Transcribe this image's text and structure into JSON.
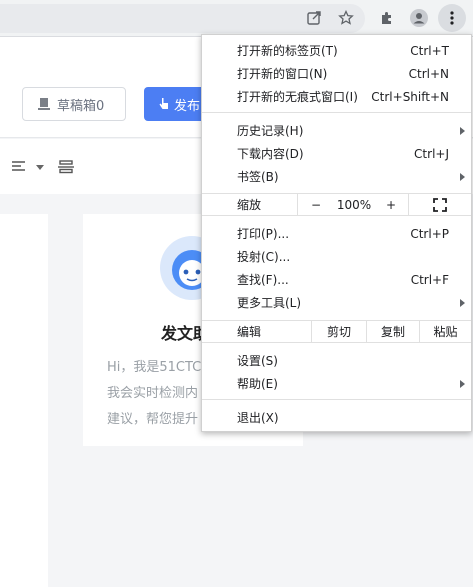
{
  "browser": {
    "icons": [
      "share-icon",
      "star-icon",
      "extensions-icon",
      "profile-icon",
      "kebab-menu-icon"
    ]
  },
  "page": {
    "draft_label": "草稿箱0",
    "publish_label": "发布",
    "assistant_title": "发文助",
    "assistant_line1": "Hi，我是51CTC",
    "assistant_line2": "我会实时检测内",
    "assistant_line3": "建议，帮您提升"
  },
  "menu": {
    "new_tab": {
      "label": "打开新的标签页(T)",
      "shortcut": "Ctrl+T"
    },
    "new_window": {
      "label": "打开新的窗口(N)",
      "shortcut": "Ctrl+N"
    },
    "new_incognito": {
      "label": "打开新的无痕式窗口(I)",
      "shortcut": "Ctrl+Shift+N"
    },
    "history": {
      "label": "历史记录(H)"
    },
    "downloads": {
      "label": "下载内容(D)",
      "shortcut": "Ctrl+J"
    },
    "bookmarks": {
      "label": "书签(B)"
    },
    "zoom": {
      "label": "缩放",
      "minus": "−",
      "value": "100%",
      "plus": "+"
    },
    "print": {
      "label": "打印(P)...",
      "shortcut": "Ctrl+P"
    },
    "cast": {
      "label": "投射(C)..."
    },
    "find": {
      "label": "查找(F)...",
      "shortcut": "Ctrl+F"
    },
    "more_tools": {
      "label": "更多工具(L)"
    },
    "edit": {
      "label": "编辑",
      "cut": "剪切",
      "copy": "复制",
      "paste": "粘贴"
    },
    "settings": {
      "label": "设置(S)"
    },
    "help": {
      "label": "帮助(E)"
    },
    "exit": {
      "label": "退出(X)"
    }
  }
}
